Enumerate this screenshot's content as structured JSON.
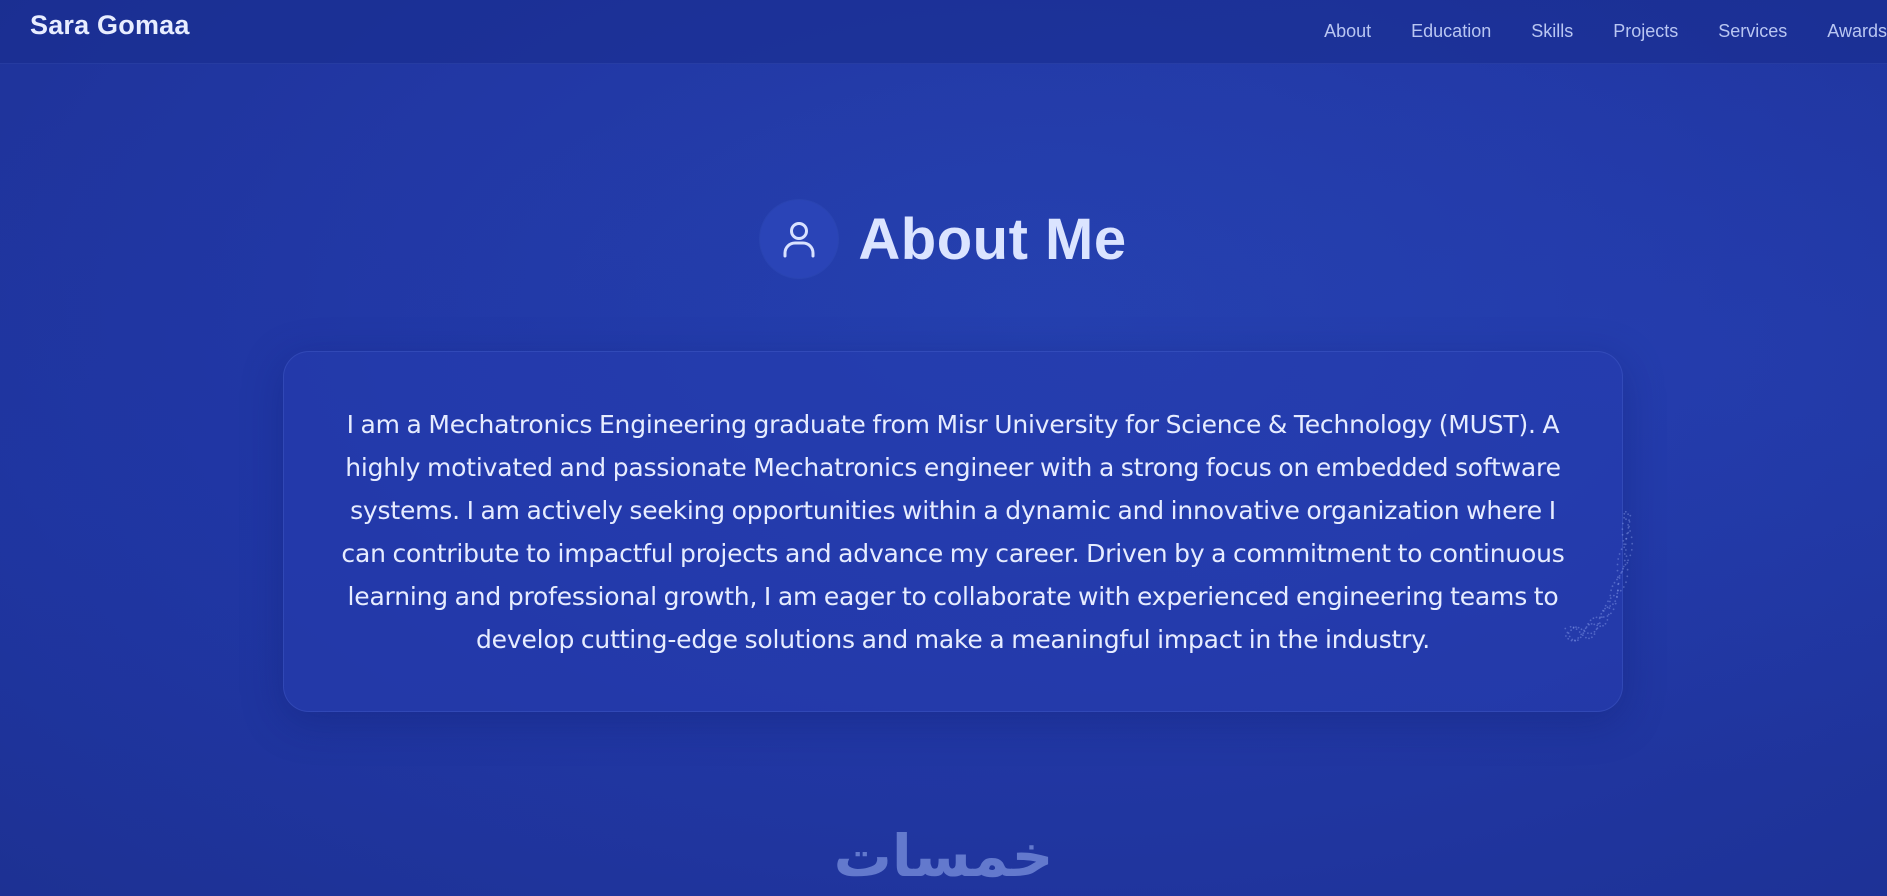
{
  "navbar": {
    "brand": "Sara Gomaa",
    "links": [
      "About",
      "Education",
      "Skills",
      "Projects",
      "Services",
      "Awards"
    ]
  },
  "about": {
    "icon": "user-icon",
    "title": "About Me",
    "text": "I am a Mechatronics Engineering graduate from Misr University for Science & Technology (MUST). A highly motivated and passionate Mechatronics engineer with a strong focus on embedded software systems. I am actively seeking opportunities within a dynamic and innovative organization where I can contribute to impactful projects and advance my career. Driven by a commitment to continuous learning and professional growth, I am eager to collaborate with experienced engineering teams to develop cutting-edge solutions and make a meaningful impact in the industry."
  },
  "watermark": {
    "text": "خمسات"
  },
  "colors": {
    "background": "#2238a5",
    "card": "#263caf",
    "accent_text": "#dbe4ff",
    "nav_text": "#b9c6f2"
  }
}
